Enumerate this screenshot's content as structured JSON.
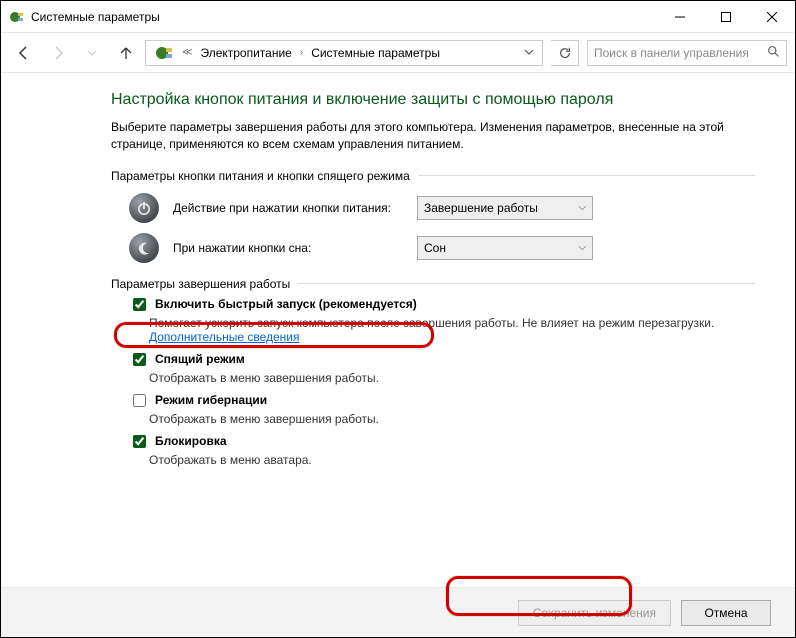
{
  "window": {
    "title": "Системные параметры"
  },
  "breadcrumbs": {
    "items": [
      "Электропитание",
      "Системные параметры"
    ]
  },
  "search": {
    "placeholder": "Поиск в панели управления"
  },
  "page": {
    "heading": "Настройка кнопок питания и включение защиты с помощью пароля",
    "intro": "Выберите параметры завершения работы для этого компьютера. Изменения параметров, внесенные на этой странице, применяются ко всем схемам управления питанием."
  },
  "section1": {
    "label": "Параметры кнопки питания и кнопки спящего режима",
    "power_btn_label": "Действие при нажатии кнопки питания:",
    "power_btn_value": "Завершение работы",
    "sleep_btn_label": "При нажатии кнопки сна:",
    "sleep_btn_value": "Сон"
  },
  "section2": {
    "label": "Параметры завершения работы",
    "fast_start": {
      "title": "Включить быстрый запуск (рекомендуется)",
      "desc_prefix": "Помогает ускорить запуск компьютера после завершения работы. Не влияет на режим перезагрузки. ",
      "link": "Дополнительные сведения",
      "checked": true
    },
    "sleep": {
      "title": "Спящий режим",
      "desc": "Отображать в меню завершения работы.",
      "checked": true
    },
    "hibernate": {
      "title": "Режим гибернации",
      "desc": "Отображать в меню завершения работы.",
      "checked": false
    },
    "lock": {
      "title": "Блокировка",
      "desc": "Отображать в меню аватара.",
      "checked": true
    }
  },
  "footer": {
    "save": "Сохранить изменения",
    "cancel": "Отмена"
  }
}
